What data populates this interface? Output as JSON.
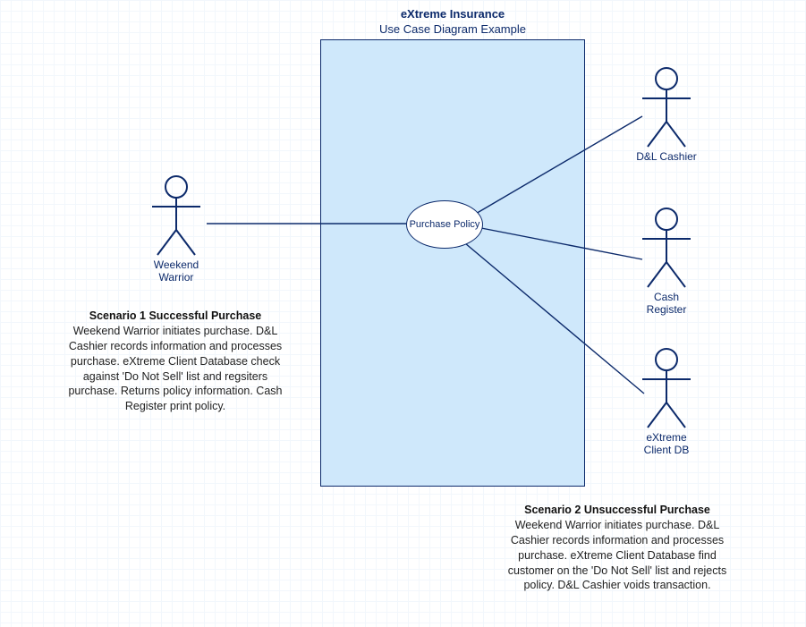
{
  "title": {
    "main": "eXtreme Insurance",
    "sub": "Use Case Diagram Example"
  },
  "usecase": {
    "label": "Purchase Policy"
  },
  "actors": {
    "left": {
      "name": "Weekend Warrior"
    },
    "right1": {
      "name": "D&L Cashier"
    },
    "right2": {
      "name": "Cash Register"
    },
    "right3": {
      "name": "eXtreme Client DB"
    }
  },
  "scenario1": {
    "heading": "Scenario 1 Successful Purchase",
    "body": "Weekend Warrior initiates purchase. D&L Cashier records information and processes purchase. eXtreme Client Database check against 'Do Not Sell' list and regsiters purchase. Returns policy information. Cash Register print policy."
  },
  "scenario2": {
    "heading": "Scenario 2 Unsuccessful Purchase",
    "body": "Weekend Warrior initiates purchase. D&L Cashier records information and processes purchase. eXtreme Client Database find customer on the 'Do Not Sell' list and rejects policy. D&L Cashier voids transaction."
  }
}
